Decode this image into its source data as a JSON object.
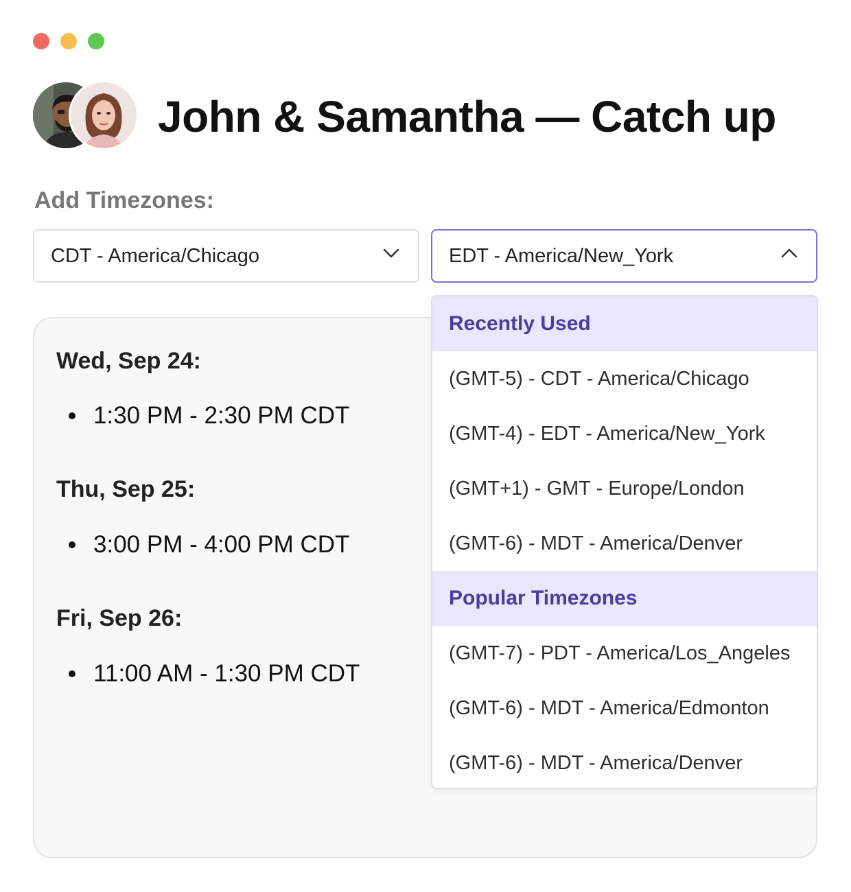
{
  "window_controls": [
    "close",
    "minimize",
    "maximize"
  ],
  "header": {
    "title": "John & Samantha — Catch up",
    "avatars": [
      "avatar-john",
      "avatar-samantha"
    ]
  },
  "timezones": {
    "label": "Add Timezones:",
    "select_one": {
      "value": "CDT - America/Chicago",
      "icon": "chevron-down-icon"
    },
    "select_two": {
      "value": "EDT - America/New_York",
      "icon": "chevron-up-icon",
      "open": true
    }
  },
  "schedule": {
    "days": [
      {
        "label": "Wed, Sep 24:",
        "slots": [
          "1:30 PM - 2:30 PM CDT"
        ]
      },
      {
        "label": "Thu, Sep 25:",
        "slots": [
          "3:00 PM - 4:00 PM CDT"
        ]
      },
      {
        "label": "Fri, Sep 26:",
        "slots": [
          "11:00 AM - 1:30 PM CDT"
        ]
      }
    ]
  },
  "dropdown": {
    "groups": [
      {
        "title": "Recently Used",
        "options": [
          "(GMT-5) - CDT - America/Chicago",
          "(GMT-4) - EDT - America/New_York",
          "(GMT+1) - GMT - Europe/London",
          "(GMT-6) - MDT - America/Denver"
        ]
      },
      {
        "title": "Popular Timezones",
        "options": [
          "(GMT-7) - PDT - America/Los_Angeles",
          "(GMT-6) - MDT - America/Edmonton",
          "(GMT-6) - MDT - America/Denver"
        ]
      }
    ]
  },
  "colors": {
    "accent": "#7b6fd6",
    "group_header_bg": "#e9e7fb",
    "group_header_text": "#4c3c9c"
  }
}
